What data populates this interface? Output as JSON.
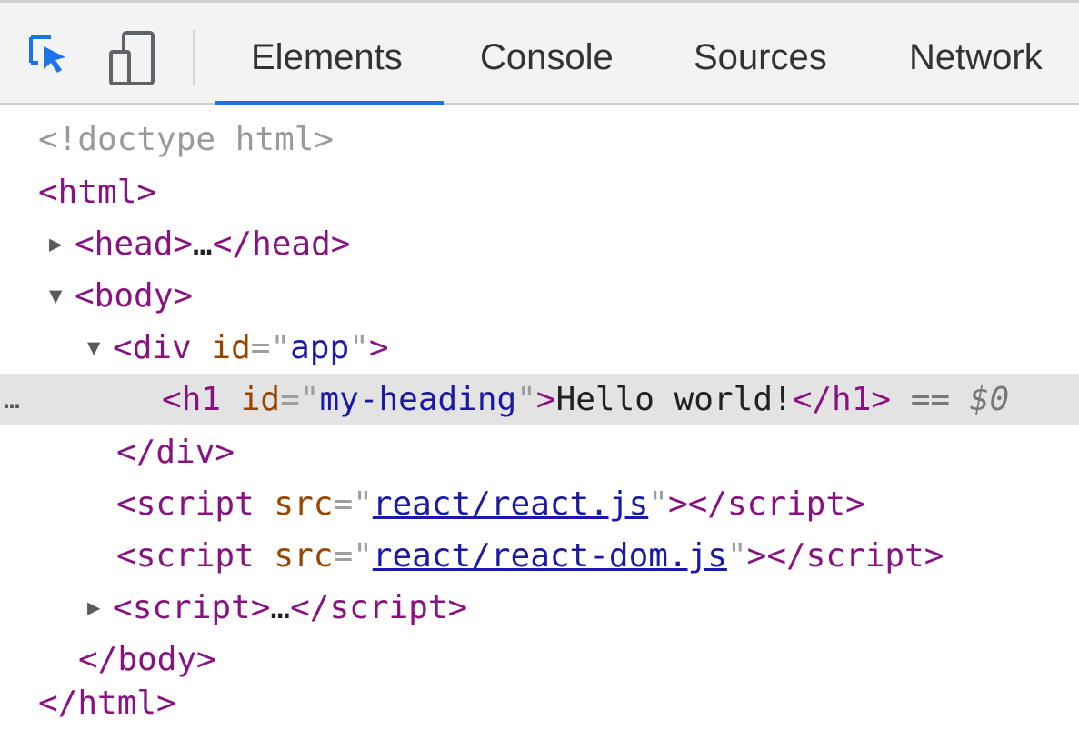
{
  "toolbar": {
    "inspect_icon": "inspect-element-icon",
    "device_icon": "device-toolbar-icon",
    "tabs": [
      {
        "label": "Elements",
        "active": true
      },
      {
        "label": "Console",
        "active": false
      },
      {
        "label": "Sources",
        "active": false
      },
      {
        "label": "Network",
        "active": false
      }
    ],
    "accent_color": "#1a73e8"
  },
  "dom_tree": {
    "doctype": "<!doctype html>",
    "html_open": "<html>",
    "head_open": "<head>",
    "head_ellipsis": "…",
    "head_close": "</head>",
    "body_open": "<body>",
    "div_tag": "div",
    "div_attr_name": "id",
    "div_attr_value": "app",
    "selected_row_ellipsis": "…",
    "h1_tag": "h1",
    "h1_attr_name": "id",
    "h1_attr_value": "my-heading",
    "h1_text": "Hello world!",
    "selected_marker": "== $0",
    "div_close": "</div>",
    "script1_attr_name": "src",
    "script1_src": "react/react.js",
    "script2_attr_name": "src",
    "script2_src": "react/react-dom.js",
    "script_tag": "script",
    "script_collapsed_ellipsis": "…",
    "body_close": "</body>",
    "html_close": "</html>"
  }
}
